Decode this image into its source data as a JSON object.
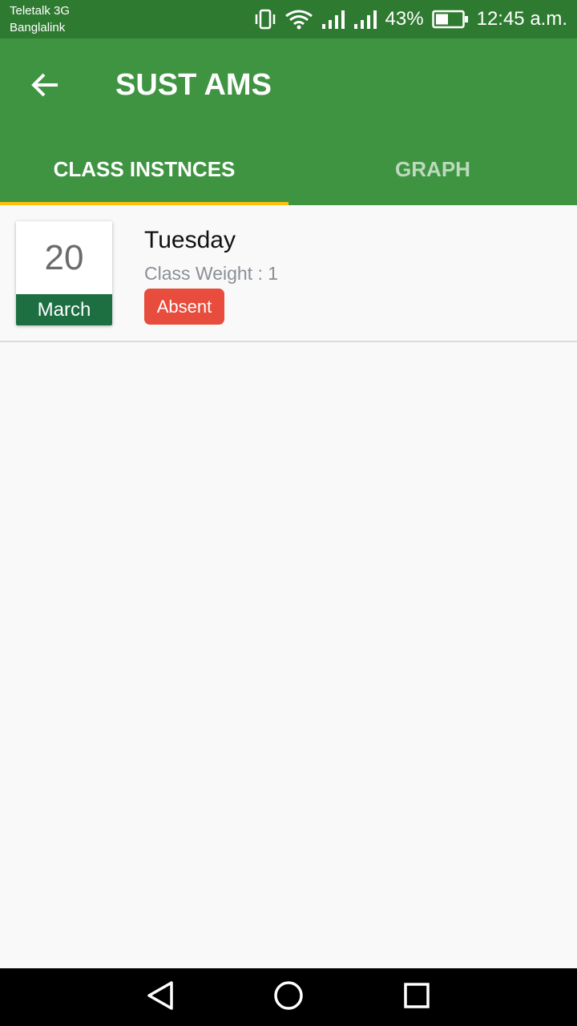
{
  "status_bar": {
    "carrier_1": "Teletalk 3G",
    "carrier_2": "Banglalink",
    "battery_percent": "43%",
    "time": "12:45 a.m.",
    "icons": [
      "vibrate-icon",
      "wifi-icon",
      "signal-icon",
      "signal-icon",
      "battery-icon"
    ]
  },
  "app_bar": {
    "title": "SUST AMS",
    "back_icon": "arrow-back-icon"
  },
  "tabs": [
    {
      "label": "CLASS INSTNCES",
      "active": true
    },
    {
      "label": "GRAPH",
      "active": false
    }
  ],
  "class_instances": [
    {
      "day": "20",
      "month": "March",
      "weekday": "Tuesday",
      "class_weight": "Class Weight : 1",
      "status": "Absent"
    }
  ],
  "colors": {
    "status_bar": "#2f7a31",
    "app_bar": "#3f9442",
    "tab_indicator": "#ffc107",
    "month_band": "#1d6e41",
    "absent_badge": "#e74c3c"
  },
  "nav_bar": {
    "icons": [
      "back-triangle-icon",
      "home-circle-icon",
      "recents-square-icon"
    ]
  }
}
